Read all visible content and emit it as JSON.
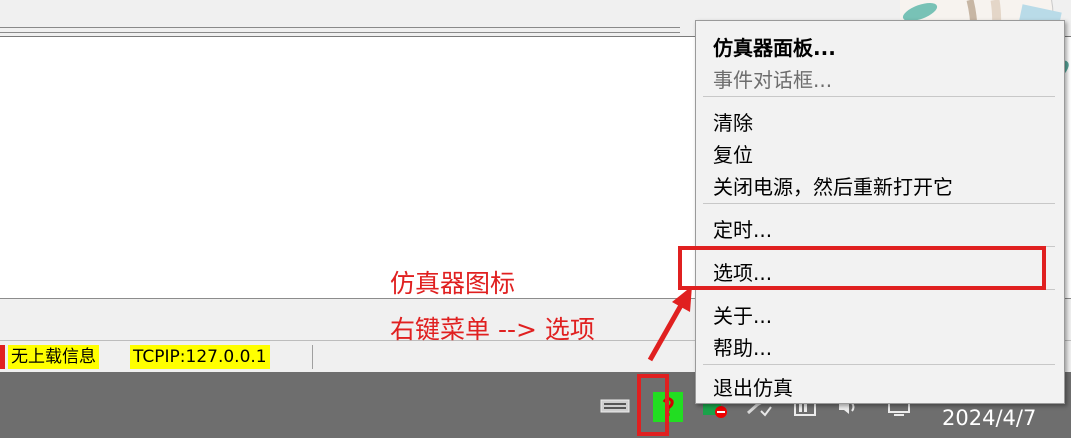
{
  "statusbar": {
    "upload_info": "无上载信息",
    "tcpip": "TCPIP:127.0.0.1"
  },
  "annotation": {
    "line1": "仿真器图标",
    "line2": "右键菜单 --> 选项"
  },
  "context_menu": {
    "items": [
      {
        "label": "仿真器面板...",
        "bold": true
      },
      {
        "label": "事件对话框...",
        "disabled": true
      },
      {
        "label": "清除"
      },
      {
        "label": "复位"
      },
      {
        "label": "关闭电源，然后重新打开它"
      },
      {
        "label": "定时..."
      },
      {
        "label": "选项...",
        "highlighted": true
      },
      {
        "label": "关于..."
      },
      {
        "label": "帮助..."
      },
      {
        "label": "退出仿真"
      }
    ]
  },
  "taskbar": {
    "date": "2024/4/7",
    "tray_icons": [
      "keyboard-icon",
      "simulator-icon",
      "network-blocked-icon",
      "network-icon",
      "battery-icon",
      "speaker-icon",
      "display-icon"
    ]
  },
  "colors": {
    "highlight": "#e02020",
    "status_yellow": "#ffff00",
    "simulator_green": "#22dd22"
  }
}
